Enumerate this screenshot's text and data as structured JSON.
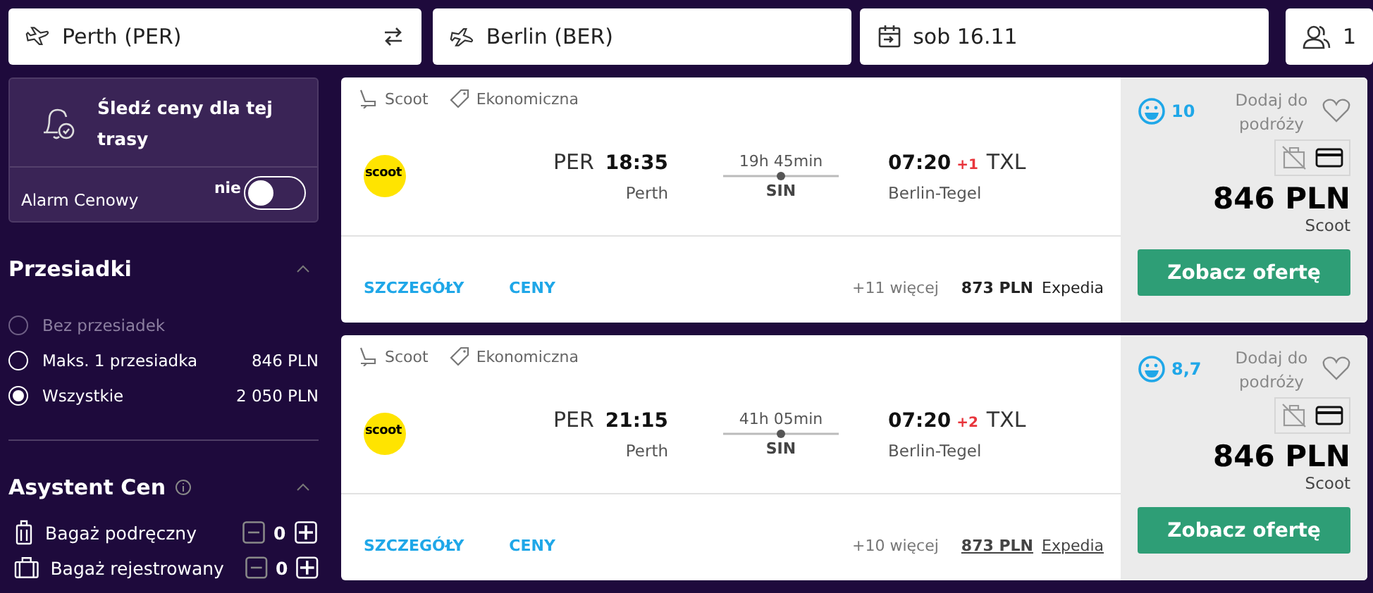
{
  "search": {
    "origin": "Perth (PER)",
    "destination": "Berlin (BER)",
    "date": "sob 16.11",
    "passengers": "1"
  },
  "price_alert": {
    "title": "Śledź ceny dla tej trasy",
    "label": "Alarm Cenowy",
    "toggle_text": "nie",
    "on": false
  },
  "stops_filter": {
    "title": "Przesiadki",
    "expanded": true,
    "options": [
      {
        "label": "Bez przesiadek",
        "disabled": true,
        "selected": false
      },
      {
        "label": "Maks. 1 przesiadka",
        "price": "846 PLN",
        "disabled": false,
        "selected": false
      },
      {
        "label": "Wszystkie",
        "price": "2 050 PLN",
        "disabled": false,
        "selected": true
      }
    ]
  },
  "price_assistant": {
    "title": "Asystent Cen",
    "expanded": true,
    "bags": [
      {
        "kind": "cabin",
        "label": "Bagaż podręczny",
        "count": "0"
      },
      {
        "kind": "checked",
        "label": "Bagaż rejestrowany",
        "count": "0"
      }
    ]
  },
  "results": [
    {
      "airline": "Scoot",
      "cabin": "Ekonomiczna",
      "logo_text": "scoot",
      "origin_code": "PER",
      "departure_time": "18:35",
      "origin_city": "Perth",
      "duration": "19h 45min",
      "stopover": "SIN",
      "arrival_time": "07:20",
      "day_offset": "+1",
      "destination_code": "TXL",
      "destination_city": "Berlin-Tegel",
      "details_link": "SZCZEGÓŁY",
      "prices_link": "CENY",
      "more_offers": "+11 więcej",
      "alt_price": "873 PLN",
      "alt_provider": "Expedia",
      "underlined": false,
      "rating": "10",
      "favorite_label": "Dodaj do podróży",
      "price": "846 PLN",
      "provider": "Scoot",
      "button": "Zobacz ofertę"
    },
    {
      "airline": "Scoot",
      "cabin": "Ekonomiczna",
      "logo_text": "scoot",
      "origin_code": "PER",
      "departure_time": "21:15",
      "origin_city": "Perth",
      "duration": "41h 05min",
      "stopover": "SIN",
      "arrival_time": "07:20",
      "day_offset": "+2",
      "destination_code": "TXL",
      "destination_city": "Berlin-Tegel",
      "details_link": "SZCZEGÓŁY",
      "prices_link": "CENY",
      "more_offers": "+10 więcej",
      "alt_price": "873 PLN",
      "alt_provider": "Expedia",
      "underlined": true,
      "rating": "8,7",
      "favorite_label": "Dodaj do podróży",
      "price": "846 PLN",
      "provider": "Scoot",
      "button": "Zobacz ofertę"
    }
  ]
}
